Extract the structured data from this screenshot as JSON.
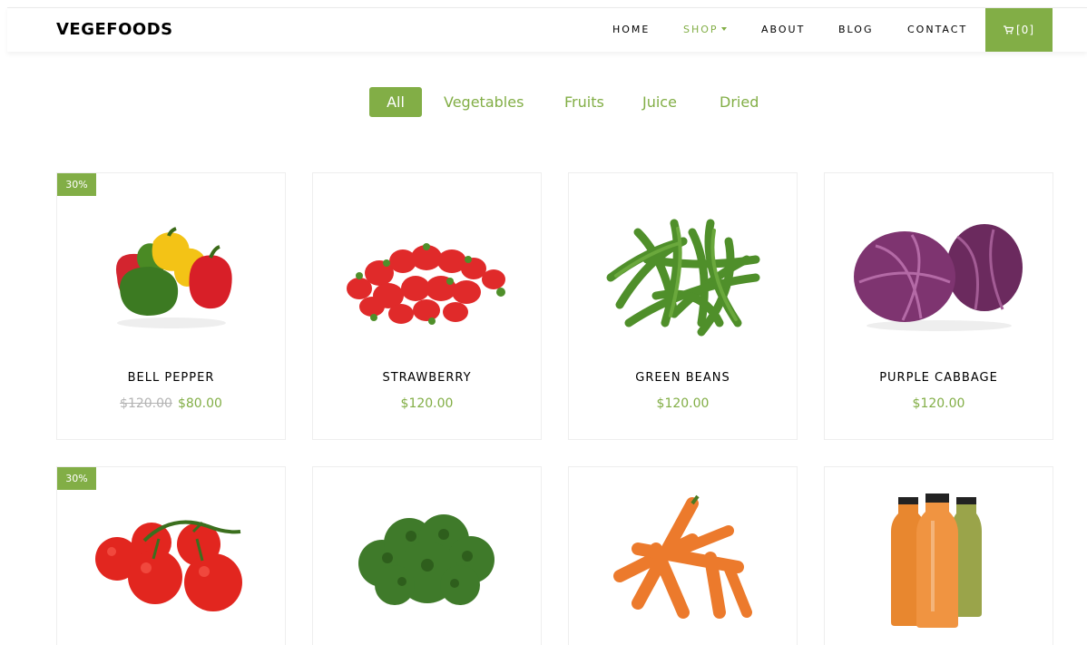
{
  "brand": "VEGEFOODS",
  "nav": {
    "items": [
      "HOME",
      "SHOP",
      "ABOUT",
      "BLOG",
      "CONTACT"
    ],
    "active": "SHOP",
    "cart_label": "[0]"
  },
  "filters": {
    "items": [
      "All",
      "Vegetables",
      "Fruits",
      "Juice",
      "Dried"
    ],
    "active": "All"
  },
  "products": [
    {
      "name": "BELL PEPPER",
      "badge": "30%",
      "old_price": "$120.00",
      "price": "$80.00"
    },
    {
      "name": "STRAWBERRY",
      "badge": "",
      "old_price": "",
      "price": "$120.00"
    },
    {
      "name": "GREEN BEANS",
      "badge": "",
      "old_price": "",
      "price": "$120.00"
    },
    {
      "name": "PURPLE CABBAGE",
      "badge": "",
      "old_price": "",
      "price": "$120.00"
    },
    {
      "name": "",
      "badge": "30%",
      "old_price": "",
      "price": ""
    },
    {
      "name": "",
      "badge": "",
      "old_price": "",
      "price": ""
    },
    {
      "name": "",
      "badge": "",
      "old_price": "",
      "price": ""
    },
    {
      "name": "",
      "badge": "",
      "old_price": "",
      "price": ""
    }
  ],
  "icons": {
    "cart": "cart-icon",
    "product_images": [
      "bell-pepper-image",
      "strawberry-image",
      "green-beans-image",
      "purple-cabbage-image",
      "tomato-image",
      "broccoli-image",
      "carrot-image",
      "juice-bottles-image"
    ]
  },
  "colors": {
    "accent": "#82ae46",
    "strike": "#b3b3b3"
  }
}
